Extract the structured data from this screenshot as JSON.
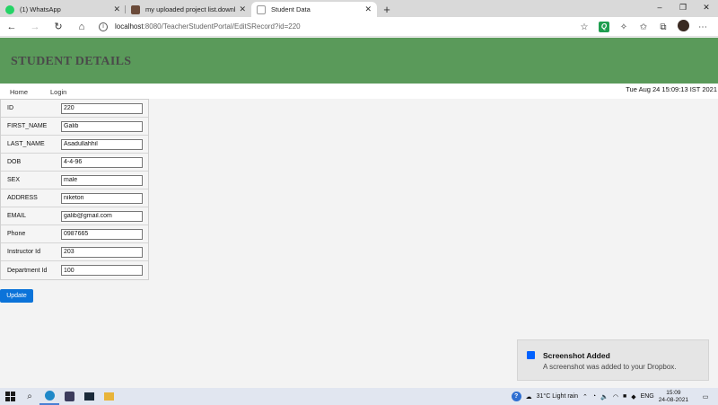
{
  "browser": {
    "tabs": [
      {
        "title": "(1) WhatsApp",
        "favicon_color": "#25d366",
        "active": false
      },
      {
        "title": "my uploaded project list.downlo",
        "favicon_color": "#6b4b3a",
        "active": false
      },
      {
        "title": "Student Data",
        "favicon_color": "#9a9a9a",
        "active": true
      }
    ],
    "new_tab_label": "+",
    "address": {
      "host": "localhost",
      "path": ":8080/TeacherStudentPortal/EditSRecord?id=220"
    }
  },
  "header": {
    "title": "STUDENT DETAILS",
    "color": "#5a9a5a"
  },
  "nav": {
    "home": "Home",
    "login": "Login",
    "timestamp": "Tue Aug 24 15:09:13 IST 2021"
  },
  "form": {
    "fields": [
      {
        "label": "ID",
        "value": "220"
      },
      {
        "label": "FIRST_NAME",
        "value": "Galib"
      },
      {
        "label": "LAST_NAME",
        "value": "Asadullahhil"
      },
      {
        "label": "DOB",
        "value": "4-4-96"
      },
      {
        "label": "SEX",
        "value": "male"
      },
      {
        "label": "ADDRESS",
        "value": "niketon"
      },
      {
        "label": "EMAIL",
        "value": "galib@gmail.com"
      },
      {
        "label": "Phone",
        "value": "0987665"
      },
      {
        "label": "Instructor Id",
        "value": "203"
      },
      {
        "label": "Department Id",
        "value": "100"
      }
    ],
    "submit_label": "Update",
    "submit_color": "#0b73d9"
  },
  "toast": {
    "title": "Screenshot Added",
    "message": "A screenshot was added to your Dropbox."
  },
  "taskbar": {
    "weather": "31°C  Light rain",
    "language": "ENG",
    "time": "15:09",
    "date": "24-08-2021"
  }
}
